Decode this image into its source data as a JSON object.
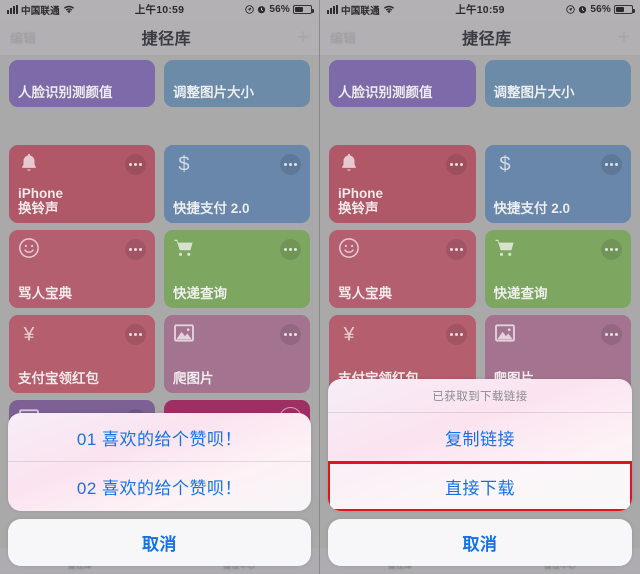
{
  "status_bar": {
    "carrier": "中国联通",
    "time": "上午10:59",
    "battery_percent": "56%",
    "icons": [
      "signal-bars-icon",
      "wifi-icon",
      "location-icon",
      "alarm-icon",
      "battery-icon"
    ]
  },
  "nav_bar": {
    "edit_label": "编辑",
    "title": "捷径库",
    "add_label": "+"
  },
  "tab_bar": {
    "tabs": [
      {
        "label": "捷径库"
      },
      {
        "label": "捷径中心"
      }
    ]
  },
  "cards": [
    {
      "title": "人脸识别测颜值",
      "color": "#7d6aa8",
      "icon": "",
      "menu": false,
      "short": true
    },
    {
      "title": "调整图片大小",
      "color": "#6c8ba8",
      "icon": "",
      "menu": false,
      "short": true
    },
    {
      "title": "iPhone\n换铃声",
      "color": "#b05868",
      "icon": "bell-icon",
      "menu": true,
      "short": false
    },
    {
      "title": "快捷支付 2.0",
      "color": "#6986ab",
      "icon": "dollar-icon",
      "menu": true,
      "short": false
    },
    {
      "title": "骂人宝典",
      "color": "#b45f70",
      "icon": "smiley-icon",
      "menu": true,
      "short": false
    },
    {
      "title": "快递查询",
      "color": "#7da661",
      "icon": "cart-icon",
      "menu": true,
      "short": false
    },
    {
      "title": "支付宝领红包",
      "color": "#b45e6e",
      "icon": "yen-icon",
      "menu": true,
      "short": false
    },
    {
      "title": "爬图片",
      "color": "#a4738f",
      "icon": "photo-icon",
      "menu": true,
      "short": false
    },
    {
      "title": "",
      "color": "#7d6195",
      "icon": "photo-icon",
      "menu": true,
      "short": false
    },
    {
      "title": "",
      "color": "#9e2f63",
      "icon": "",
      "menu": false,
      "running": true,
      "short": false
    }
  ],
  "left_panel": {
    "action_sheet": {
      "options": [
        {
          "label": "01 喜欢的给个赞呗！",
          "highlighted": false
        },
        {
          "label": "02 喜欢的给个赞呗！",
          "highlighted": false
        }
      ],
      "cancel_label": "取消"
    }
  },
  "right_panel": {
    "action_sheet": {
      "title": "已获取到下载链接",
      "options": [
        {
          "label": "复制链接",
          "highlighted": false
        },
        {
          "label": "直接下载",
          "highlighted": true
        }
      ],
      "cancel_label": "取消"
    },
    "highlight_color": "#e3131b"
  }
}
